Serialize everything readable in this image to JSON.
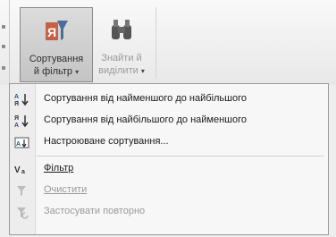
{
  "ribbon": {
    "sort_filter": {
      "label_line1": "Сортування",
      "label_line2": "й фільтр",
      "arrow": "▾"
    },
    "find_select": {
      "label_line1": "Знайти й",
      "label_line2": "виділити",
      "arrow": "▾"
    }
  },
  "menu": {
    "items": [
      {
        "icon": "sort-ascending-icon",
        "label": "Сортування від найменшого до найбільшого",
        "enabled": true
      },
      {
        "icon": "sort-descending-icon",
        "label": "Сортування від найбільшого до найменшого",
        "enabled": true
      },
      {
        "icon": "custom-sort-icon",
        "label": "Настроюване сортування...",
        "enabled": true
      },
      {
        "icon": "filter-icon",
        "label": "Фільтр",
        "enabled": true
      },
      {
        "icon": "clear-filter-icon",
        "label": "Очистити",
        "enabled": false
      },
      {
        "icon": "reapply-icon",
        "label": "Застосувати повторно",
        "enabled": false
      }
    ]
  }
}
